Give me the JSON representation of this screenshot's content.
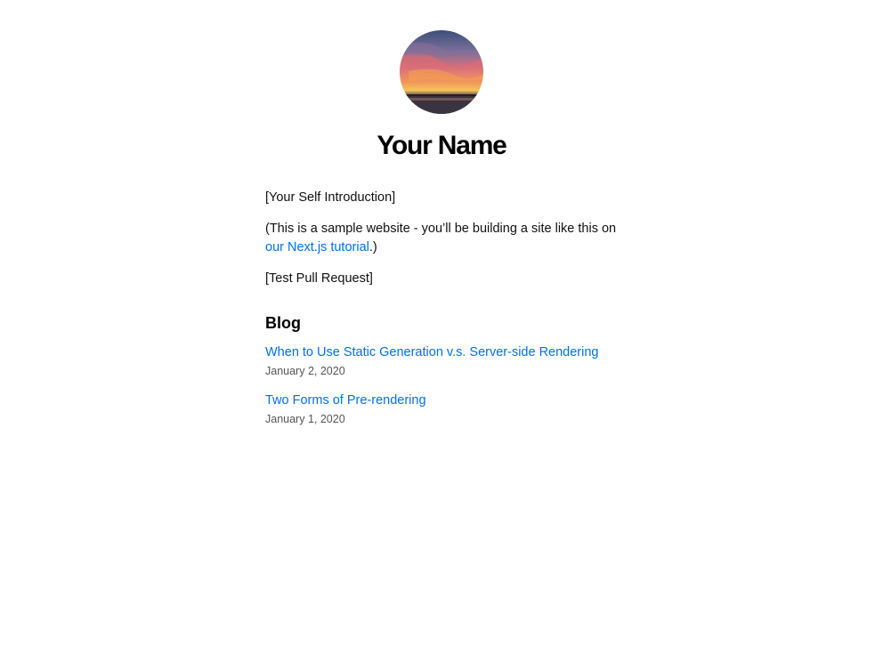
{
  "profile": {
    "name": "Your Name",
    "avatar_icon": "sunset-photo"
  },
  "intro": {
    "self_intro": "[Your Self Introduction]",
    "sample_prefix": "(This is a sample website - you’ll be building a site like this on ",
    "tutorial_link": "our Next.js tutorial",
    "sample_suffix": ".)",
    "test_pr": "[Test Pull Request]"
  },
  "blog": {
    "heading": "Blog",
    "posts": [
      {
        "title": "When to Use Static Generation v.s. Server-side Rendering",
        "date": "January 2, 2020"
      },
      {
        "title": "Two Forms of Pre-rendering",
        "date": "January 1, 2020"
      }
    ]
  },
  "colors": {
    "link": "#0070f3",
    "text": "#111111",
    "date": "#555555"
  }
}
